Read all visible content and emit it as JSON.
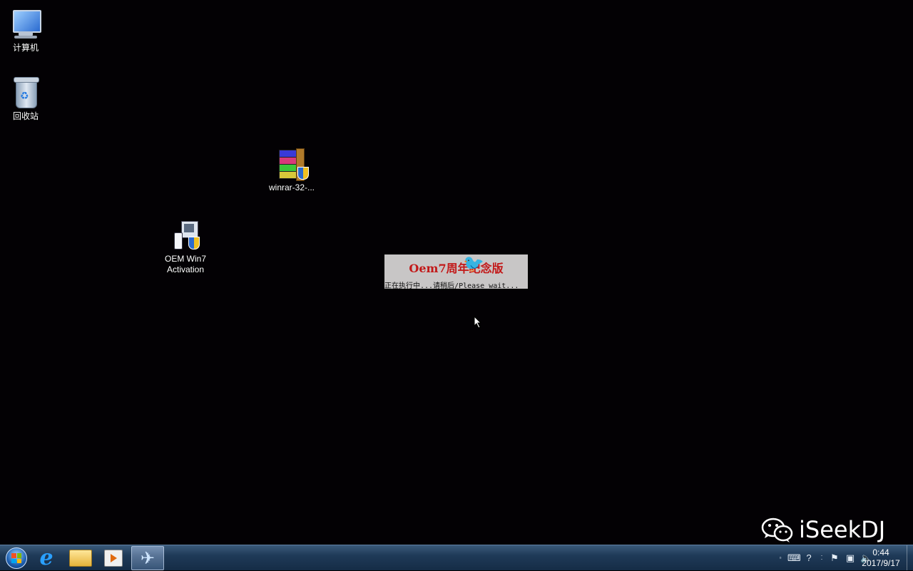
{
  "desktop": {
    "icons": [
      {
        "label": "计算机"
      },
      {
        "label": "回收站"
      },
      {
        "label": "winrar-32-..."
      },
      {
        "label": "OEM Win7\nActivation"
      }
    ]
  },
  "splash": {
    "title": "Oem7周年纪念版",
    "status": "正在执行中...请稍后/Please wait..."
  },
  "watermark": {
    "text": "iSeekDJ"
  },
  "taskbar": {
    "pinned": [
      {
        "icon": "internet-explorer-icon"
      },
      {
        "icon": "folder-icon"
      },
      {
        "icon": "media-player-icon"
      },
      {
        "icon": "paper-plane-icon"
      }
    ],
    "clock": {
      "time": "0:44",
      "date": "2017/9/17"
    }
  },
  "colors": {
    "desktop_bg": "#030104",
    "splash_title": "#c21818",
    "taskbar": "#1f3a58"
  }
}
